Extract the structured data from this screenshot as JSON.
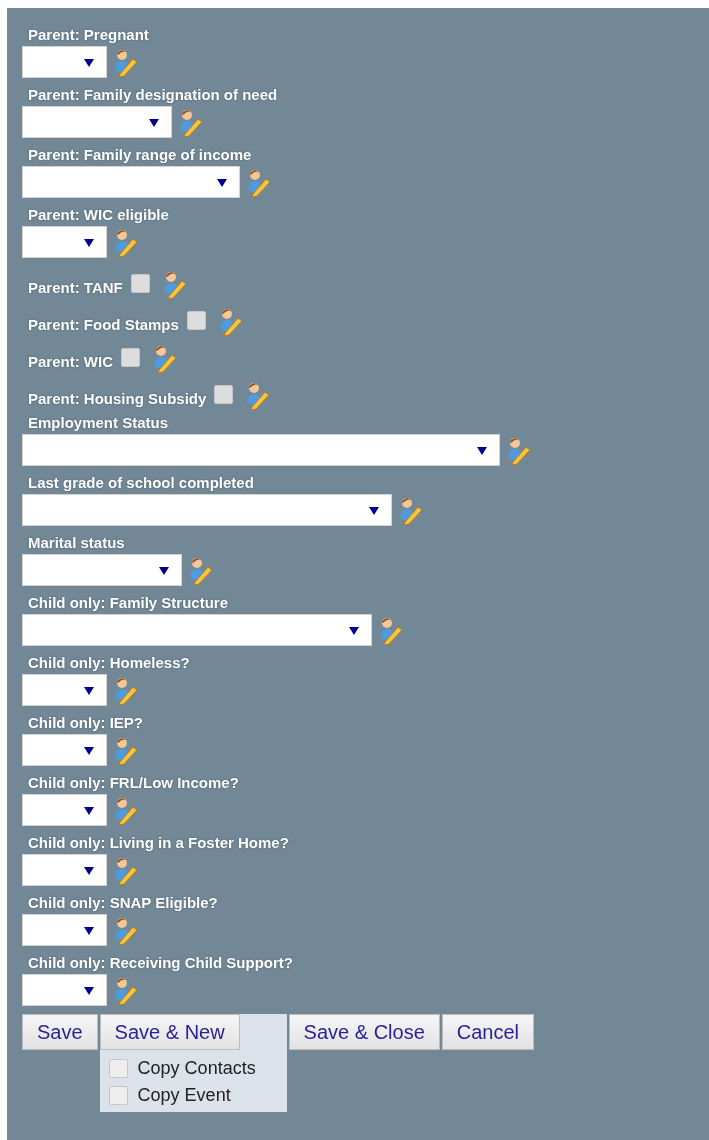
{
  "fields": [
    {
      "kind": "select",
      "label": "Parent: Pregnant"
    },
    {
      "kind": "select",
      "label": "Parent: Family designation of need"
    },
    {
      "kind": "select",
      "label": "Parent: Family range of income"
    },
    {
      "kind": "select",
      "label": "Parent: WIC eligible"
    },
    {
      "kind": "checkbox",
      "label": "Parent: TANF",
      "checked": false
    },
    {
      "kind": "checkbox",
      "label": "Parent: Food Stamps",
      "checked": false
    },
    {
      "kind": "checkbox",
      "label": "Parent: WIC",
      "checked": false
    },
    {
      "kind": "checkbox",
      "label": "Parent: Housing Subsidy",
      "checked": false
    },
    {
      "kind": "select",
      "label": "Employment Status"
    },
    {
      "kind": "select",
      "label": "Last grade of school completed"
    },
    {
      "kind": "select",
      "label": "Marital status"
    },
    {
      "kind": "select",
      "label": "Child only: Family Structure"
    },
    {
      "kind": "select",
      "label": "Child only: Homeless?"
    },
    {
      "kind": "select",
      "label": "Child only: IEP?"
    },
    {
      "kind": "select",
      "label": "Child only: FRL/Low Income?"
    },
    {
      "kind": "select",
      "label": "Child only: Living in a Foster Home?"
    },
    {
      "kind": "select",
      "label": "Child only: SNAP Eligible?"
    },
    {
      "kind": "select",
      "label": "Child only: Receiving Child Support?"
    }
  ],
  "buttons": [
    {
      "label": "Save"
    },
    {
      "label": "Save & New",
      "options": [
        {
          "label": "Copy Contacts",
          "checked": false
        },
        {
          "label": "Copy Event",
          "checked": false
        }
      ]
    },
    {
      "label": "Save & Close"
    },
    {
      "label": "Cancel"
    }
  ]
}
